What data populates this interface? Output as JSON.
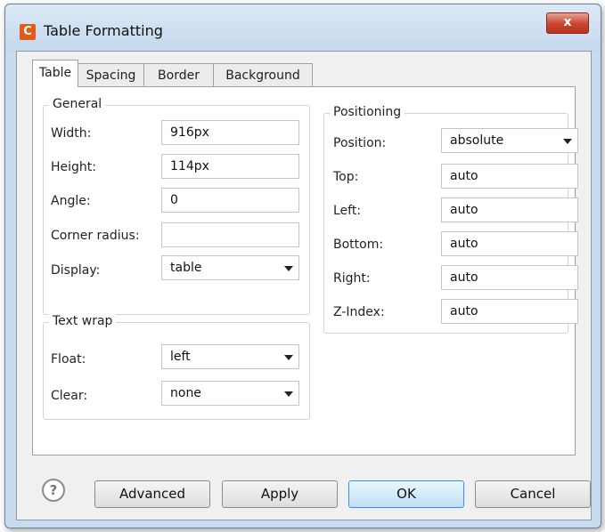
{
  "window": {
    "title": "Table Formatting",
    "app_icon_letter": "C",
    "close_label": "x"
  },
  "tabs": [
    "Table",
    "Spacing",
    "Border",
    "Background"
  ],
  "general": {
    "legend": "General",
    "width": {
      "label": "Width:",
      "value": "916px"
    },
    "height": {
      "label": "Height:",
      "value": "114px"
    },
    "angle": {
      "label": "Angle:",
      "value": "0"
    },
    "corner_radius": {
      "label": "Corner radius:",
      "value": ""
    },
    "display": {
      "label": "Display:",
      "value": "table"
    }
  },
  "text_wrap": {
    "legend": "Text wrap",
    "float": {
      "label": "Float:",
      "value": "left"
    },
    "clear": {
      "label": "Clear:",
      "value": "none"
    }
  },
  "positioning": {
    "legend": "Positioning",
    "position": {
      "label": "Position:",
      "value": "absolute"
    },
    "top": {
      "label": "Top:",
      "value": "auto"
    },
    "left": {
      "label": "Left:",
      "value": "auto"
    },
    "bottom": {
      "label": "Bottom:",
      "value": "auto"
    },
    "right": {
      "label": "Right:",
      "value": "auto"
    },
    "z_index": {
      "label": "Z-Index:",
      "value": "auto"
    }
  },
  "buttons": {
    "help": "?",
    "advanced": "Advanced",
    "apply": "Apply",
    "ok": "OK",
    "cancel": "Cancel"
  }
}
